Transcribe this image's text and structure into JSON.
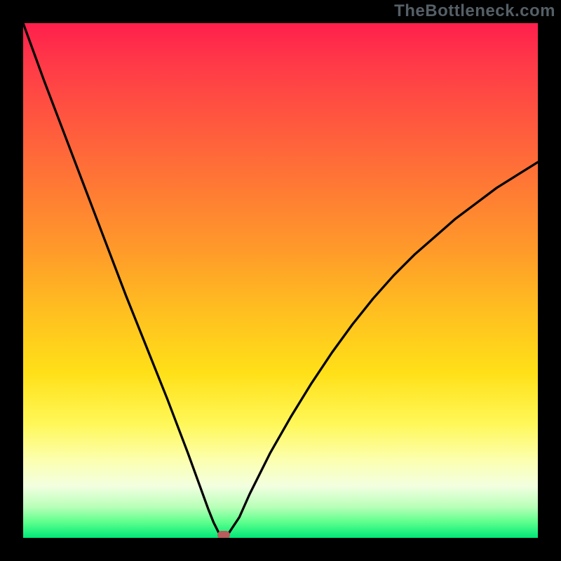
{
  "watermark": "TheBottleneck.com",
  "chart_data": {
    "type": "line",
    "title": "",
    "xlabel": "",
    "ylabel": "",
    "xlim": [
      0,
      100
    ],
    "ylim": [
      0,
      100
    ],
    "series": [
      {
        "name": "curve",
        "x": [
          0,
          4,
          8,
          12,
          16,
          20,
          24,
          28,
          32,
          34,
          36,
          37,
          38,
          39,
          40,
          42,
          44,
          48,
          52,
          56,
          60,
          64,
          68,
          72,
          76,
          80,
          84,
          88,
          92,
          96,
          100
        ],
        "y": [
          100,
          89,
          78.5,
          68,
          57.5,
          47,
          37,
          27,
          16.5,
          11,
          5.5,
          3,
          1,
          0.5,
          1,
          4,
          8.5,
          16.5,
          23.5,
          30,
          36,
          41.5,
          46.5,
          51,
          55,
          58.5,
          62,
          65,
          68,
          70.5,
          73
        ]
      }
    ],
    "marker": {
      "x": 39,
      "y": 0.5
    },
    "gradient_colors": {
      "top": "#ff1f4c",
      "upper_mid": "#ff9a2a",
      "mid": "#ffe018",
      "lower_mid": "#fcffb0",
      "bottom": "#00e878"
    }
  }
}
